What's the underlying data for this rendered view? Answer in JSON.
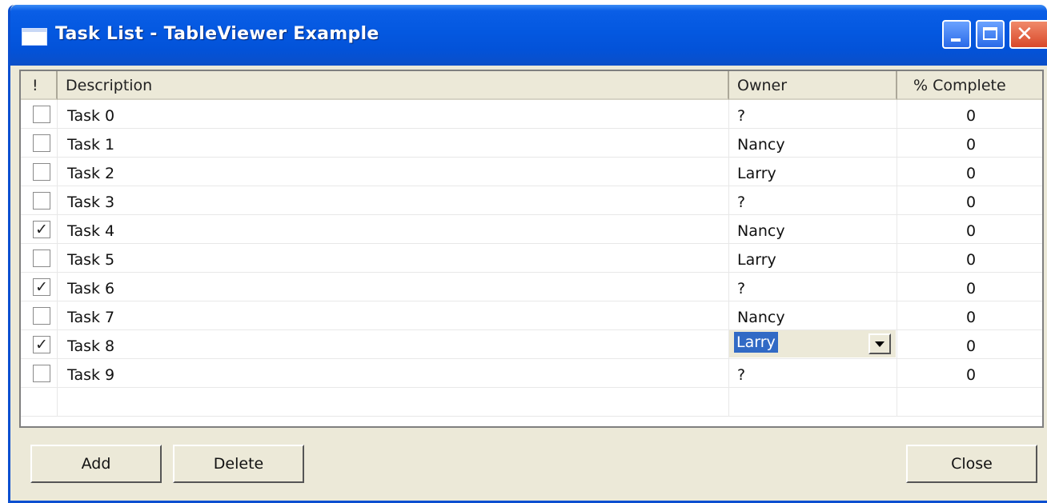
{
  "window": {
    "title": "Task List - TableViewer Example"
  },
  "table": {
    "columns": [
      "!",
      "Description",
      "Owner",
      "% Complete"
    ],
    "rows": [
      {
        "done": false,
        "description": "Task 0",
        "owner": "?",
        "percent": "0"
      },
      {
        "done": false,
        "description": "Task 1",
        "owner": "Nancy",
        "percent": "0"
      },
      {
        "done": false,
        "description": "Task 2",
        "owner": "Larry",
        "percent": "0"
      },
      {
        "done": false,
        "description": "Task 3",
        "owner": "?",
        "percent": "0"
      },
      {
        "done": true,
        "description": "Task 4",
        "owner": "Nancy",
        "percent": "0"
      },
      {
        "done": false,
        "description": "Task 5",
        "owner": "Larry",
        "percent": "0"
      },
      {
        "done": true,
        "description": "Task 6",
        "owner": "?",
        "percent": "0"
      },
      {
        "done": false,
        "description": "Task 7",
        "owner": "Nancy",
        "percent": "0"
      },
      {
        "done": true,
        "description": "Task 8",
        "owner": "Larry",
        "percent": "0",
        "editing_owner": true
      },
      {
        "done": false,
        "description": "Task 9",
        "owner": "?",
        "percent": "0"
      }
    ]
  },
  "buttons": {
    "add": "Add",
    "delete": "Delete",
    "close": "Close"
  },
  "icons": {
    "window": "window-icon",
    "minimize": "minimize-icon",
    "maximize": "maximize-icon",
    "close": "close-icon",
    "dropdown": "dropdown-arrow-icon",
    "check": "checkmark-icon"
  },
  "colors": {
    "titlebar": "#0458e0",
    "selection": "#316ac5",
    "dialog": "#ece9d8"
  }
}
